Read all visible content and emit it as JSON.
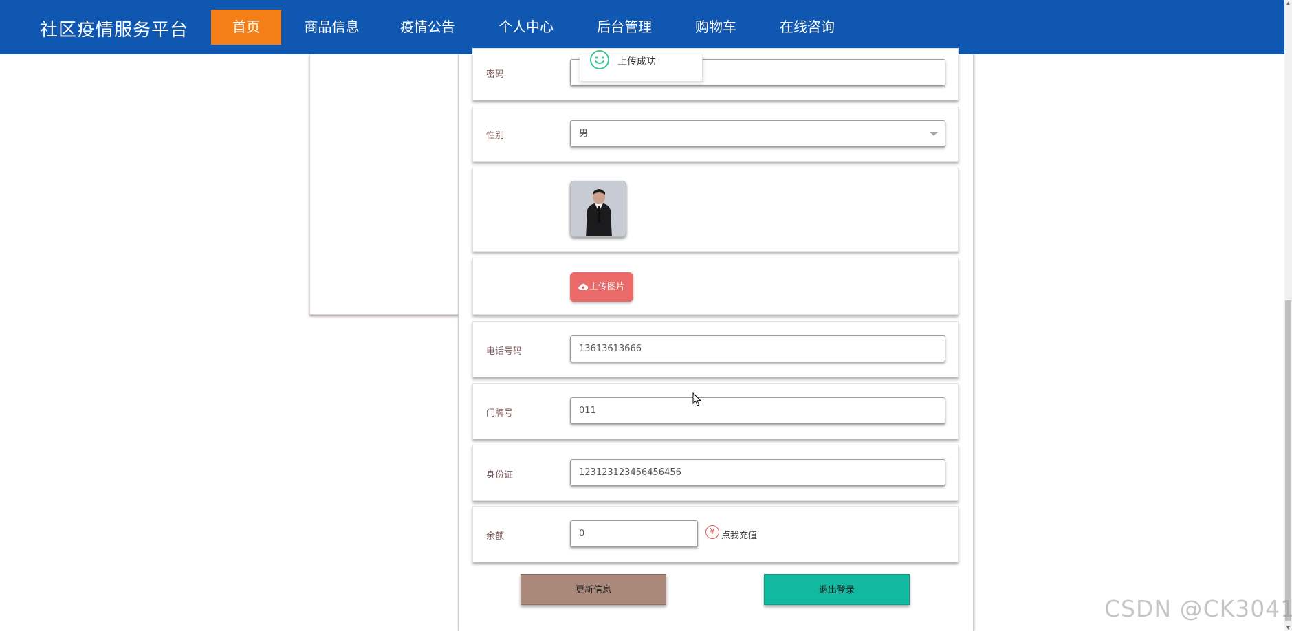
{
  "nav": {
    "brand": "社区疫情服务平台",
    "items": [
      {
        "label": "首页",
        "active": true
      },
      {
        "label": "商品信息",
        "active": false
      },
      {
        "label": "疫情公告",
        "active": false
      },
      {
        "label": "个人中心",
        "active": false
      },
      {
        "label": "后台管理",
        "active": false
      },
      {
        "label": "购物车",
        "active": false
      },
      {
        "label": "在线咨询",
        "active": false
      }
    ]
  },
  "form": {
    "password": {
      "label": "密码",
      "value": ""
    },
    "gender": {
      "label": "性别",
      "value": "男"
    },
    "avatar": {
      "alt": "avatar"
    },
    "upload": {
      "label": "上传图片"
    },
    "phone": {
      "label": "电话号码",
      "value": "13613613666"
    },
    "door": {
      "label": "门牌号",
      "value": "011"
    },
    "id_card": {
      "label": "身份证",
      "value": "123123123456456456"
    },
    "balance": {
      "label": "余额",
      "value": "0",
      "currency_symbol": "¥",
      "recharge_label": "点我充值"
    }
  },
  "actions": {
    "update_label": "更新信息",
    "logout_label": "退出登录"
  },
  "toast": {
    "message": "上传成功"
  },
  "watermark": "CSDN @CK3041",
  "colors": {
    "nav_bg": "#0f57b0",
    "nav_active": "#f57f17",
    "upload_btn": "#ea6a6a",
    "update_btn": "#ab897a",
    "logout_btn": "#12b9a1"
  }
}
